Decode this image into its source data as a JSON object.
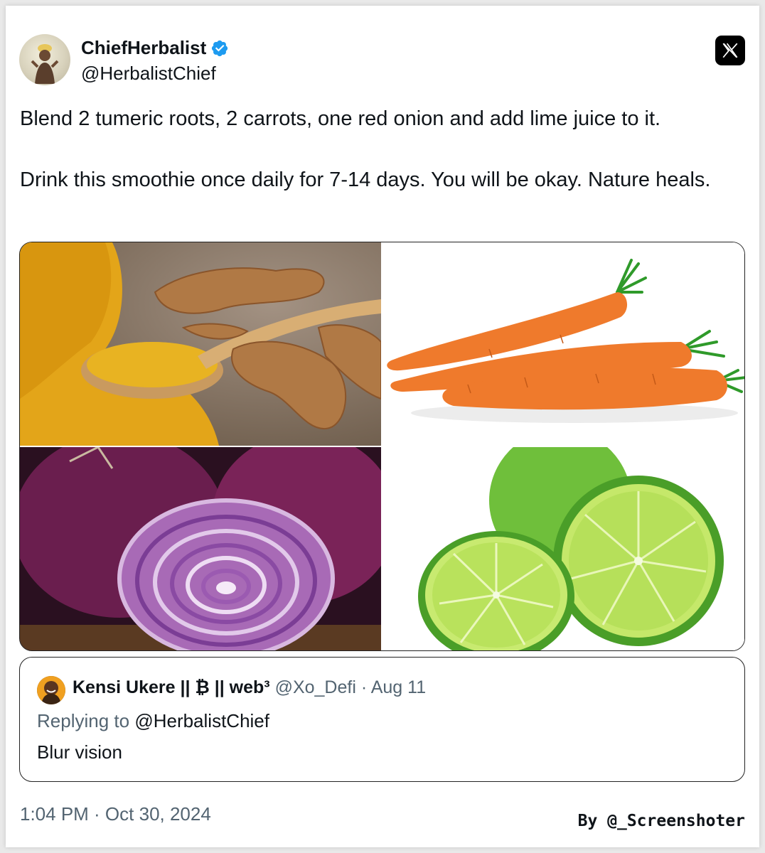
{
  "author": {
    "name": "ChiefHerbalist",
    "handle": "@HerbalistChief"
  },
  "tweet": {
    "paragraphs": [
      "Blend 2 tumeric roots, 2 carrots, one red onion and add lime juice to it.",
      "Drink this smoothie once daily for 7-14 days. You will be okay. Nature heals."
    ],
    "timestamp": "1:04 PM · Oct 30, 2024"
  },
  "media": {
    "images": [
      "turmeric",
      "carrots",
      "red-onion",
      "limes"
    ]
  },
  "quote": {
    "name": "Kensi Ukere || ₿ || web³",
    "meta": "@Xo_Defi · Aug 11",
    "reply_prefix": "Replying to",
    "reply_mention": "@HerbalistChief",
    "body": "Blur vision"
  },
  "credit": "By @_Screenshoter",
  "colors": {
    "verified": "#1d9bf0",
    "secondary_text": "#536471",
    "primary_text": "#0f1419"
  }
}
